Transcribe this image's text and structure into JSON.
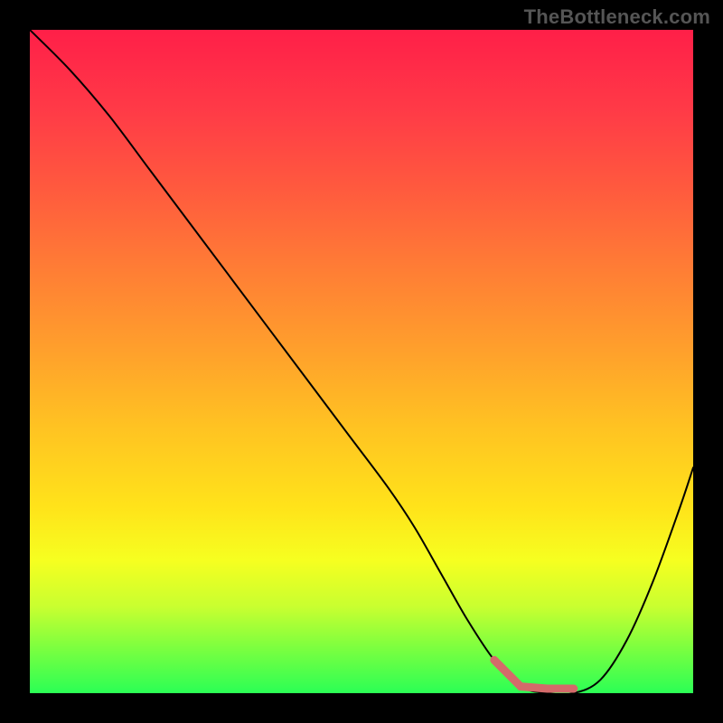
{
  "watermark": "TheBottleneck.com",
  "chart_data": {
    "type": "line",
    "title": "",
    "xlabel": "",
    "ylabel": "",
    "xlim": [
      0,
      100
    ],
    "ylim": [
      0,
      100
    ],
    "series": [
      {
        "name": "bottleneck-curve",
        "x": [
          0,
          6,
          12,
          18,
          24,
          30,
          36,
          42,
          48,
          54,
          58,
          62,
          66,
          70,
          74,
          78,
          82,
          86,
          90,
          94,
          98,
          100
        ],
        "y": [
          100,
          94,
          87,
          79,
          71,
          63,
          55,
          47,
          39,
          31,
          25,
          18,
          11,
          5,
          1,
          0,
          0,
          2,
          8,
          17,
          28,
          34
        ]
      }
    ],
    "annotations": [
      {
        "name": "valley-highlight",
        "x_range": [
          70,
          84
        ],
        "y": 0,
        "color": "#d46a6a"
      }
    ],
    "background_gradient": {
      "stops": [
        {
          "pos": 0.0,
          "color": "#ff1f48"
        },
        {
          "pos": 0.5,
          "color": "#ff9f2c"
        },
        {
          "pos": 0.78,
          "color": "#ffe31a"
        },
        {
          "pos": 1.0,
          "color": "#2bff55"
        }
      ]
    }
  }
}
